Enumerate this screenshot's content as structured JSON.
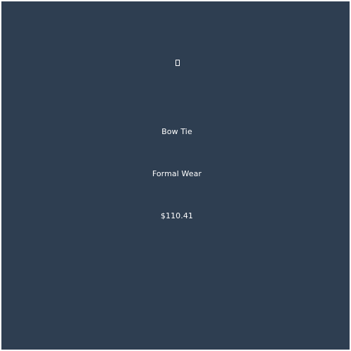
{
  "product": {
    "icon": "placeholder-box-icon",
    "name": "Bow Tie",
    "category": "Formal Wear",
    "price": "$110.41"
  },
  "colors": {
    "background": "#2e3e51",
    "text": "#ffffff",
    "border": "#ffffff"
  }
}
